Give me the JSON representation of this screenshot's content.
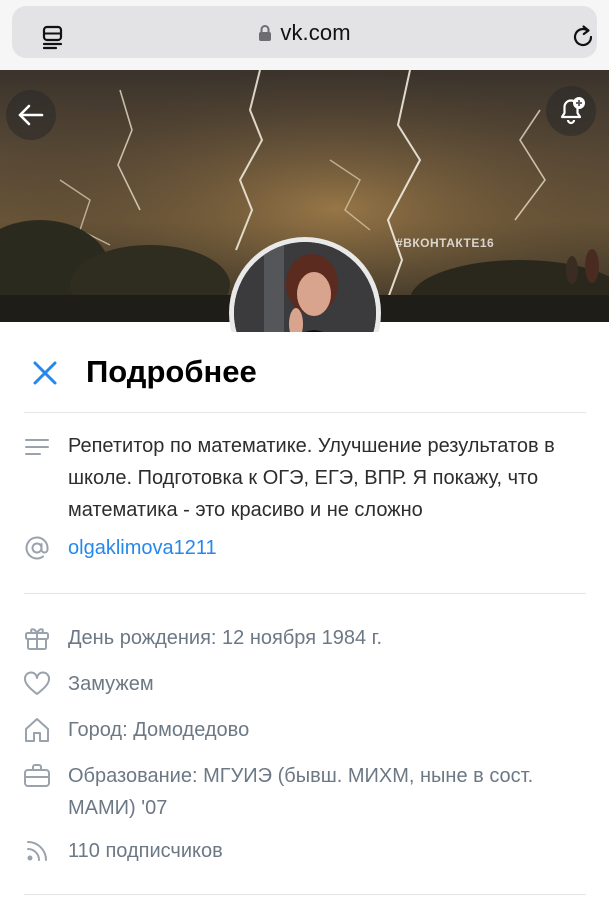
{
  "browser": {
    "url": "vk.com"
  },
  "cover": {
    "hashtag": "#ВКОНТАКТЕ16"
  },
  "sheet": {
    "title": "Подробнее",
    "about": "Репетитор по математике. Улучшение результатов в школе. Подготовка к ОГЭ, ЕГЭ, ВПР. Я покажу, что математика - это красиво и не сложно",
    "nickname": "olgaklimova1211",
    "birthday": "День рождения: 12 ноября 1984 г.",
    "relationship": "Замужем",
    "city": "Город: Домодедово",
    "education": "Образование: МГУИЭ (бывш. МИХМ, ныне в сост. МАМИ) '07",
    "followers": "110 подписчиков"
  },
  "icons": {
    "menu": "reader-menu-icon",
    "lock": "lock-icon",
    "reload": "reload-icon",
    "back": "back-arrow-icon",
    "bell": "add-notification-bell-icon",
    "close": "close-icon",
    "about": "text-lines-icon",
    "nickname": "at-sign-icon",
    "birthday": "gift-icon",
    "relationship": "heart-icon",
    "city": "home-icon",
    "education": "briefcase-icon",
    "followers": "rss-icon"
  },
  "colors": {
    "accent": "#2688eb",
    "text": "#2c2d2e",
    "secondary": "#6d7885",
    "icon": "#99a2ad"
  }
}
